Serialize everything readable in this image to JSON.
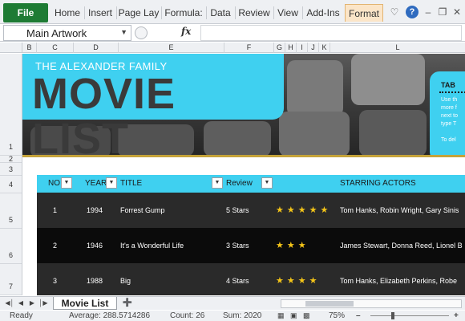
{
  "ribbon": {
    "tabs": [
      {
        "label": "File"
      },
      {
        "label": "Home"
      },
      {
        "label": "Insert"
      },
      {
        "label": "Page Lay"
      },
      {
        "label": "Formula:"
      },
      {
        "label": "Data"
      },
      {
        "label": "Review"
      },
      {
        "label": "View"
      },
      {
        "label": "Add-Ins"
      },
      {
        "label": "Format"
      }
    ],
    "icons": [
      "heart-outline-icon",
      "help-icon",
      "minimize-icon",
      "restore-icon",
      "close-icon"
    ],
    "icon_glyphs": {
      "heart": "♡",
      "help": "?",
      "minimize": "–",
      "restore": "❐",
      "close": "✕"
    }
  },
  "formula_bar": {
    "name_box_value": "Main Artwork",
    "fx_label": "fx",
    "formula_value": ""
  },
  "columns": [
    "B",
    "C",
    "D",
    "E",
    "F",
    "G",
    "H",
    "I",
    "J",
    "K",
    "L"
  ],
  "rows": [
    "1",
    "2",
    "3",
    "4",
    "5",
    "6",
    "7"
  ],
  "banner": {
    "family": "THE ALEXANDER FAMILY",
    "title": "MOVIE LIST",
    "info_title": "TAB",
    "info_lines": [
      "Use th",
      "more f",
      "next to",
      "type T",
      "To del"
    ]
  },
  "table": {
    "headers": [
      "NO",
      "YEAR",
      "TITLE",
      "Review",
      "STARRING ACTORS"
    ],
    "rows": [
      {
        "no": "1",
        "year": "1994",
        "title": "Forrest Gump",
        "review": "5 Stars",
        "stars": "★★★★★",
        "actors": "Tom Hanks, Robin Wright, Gary Sinis"
      },
      {
        "no": "2",
        "year": "1946",
        "title": "It's a Wonderful Life",
        "review": "3 Stars",
        "stars": "★★★",
        "actors": "James Stewart, Donna Reed, Lionel B"
      },
      {
        "no": "3",
        "year": "1988",
        "title": "Big",
        "review": "4 Stars",
        "stars": "★★★★",
        "actors": "Tom Hanks, Elizabeth Perkins, Robe"
      }
    ]
  },
  "sheet_tabs": {
    "active": "Movie List"
  },
  "status": {
    "ready": "Ready",
    "average": "Average: 288.5714286",
    "count": "Count: 26",
    "sum": "Sum: 2020",
    "zoom": "75%",
    "zoom_fraction": 0.3
  },
  "colors": {
    "accent": "#3fd0f0",
    "dark_row": "#0b0b0b",
    "alt_row": "#2a2a2a",
    "star": "#f5c518",
    "file_tab": "#1e7b34"
  }
}
